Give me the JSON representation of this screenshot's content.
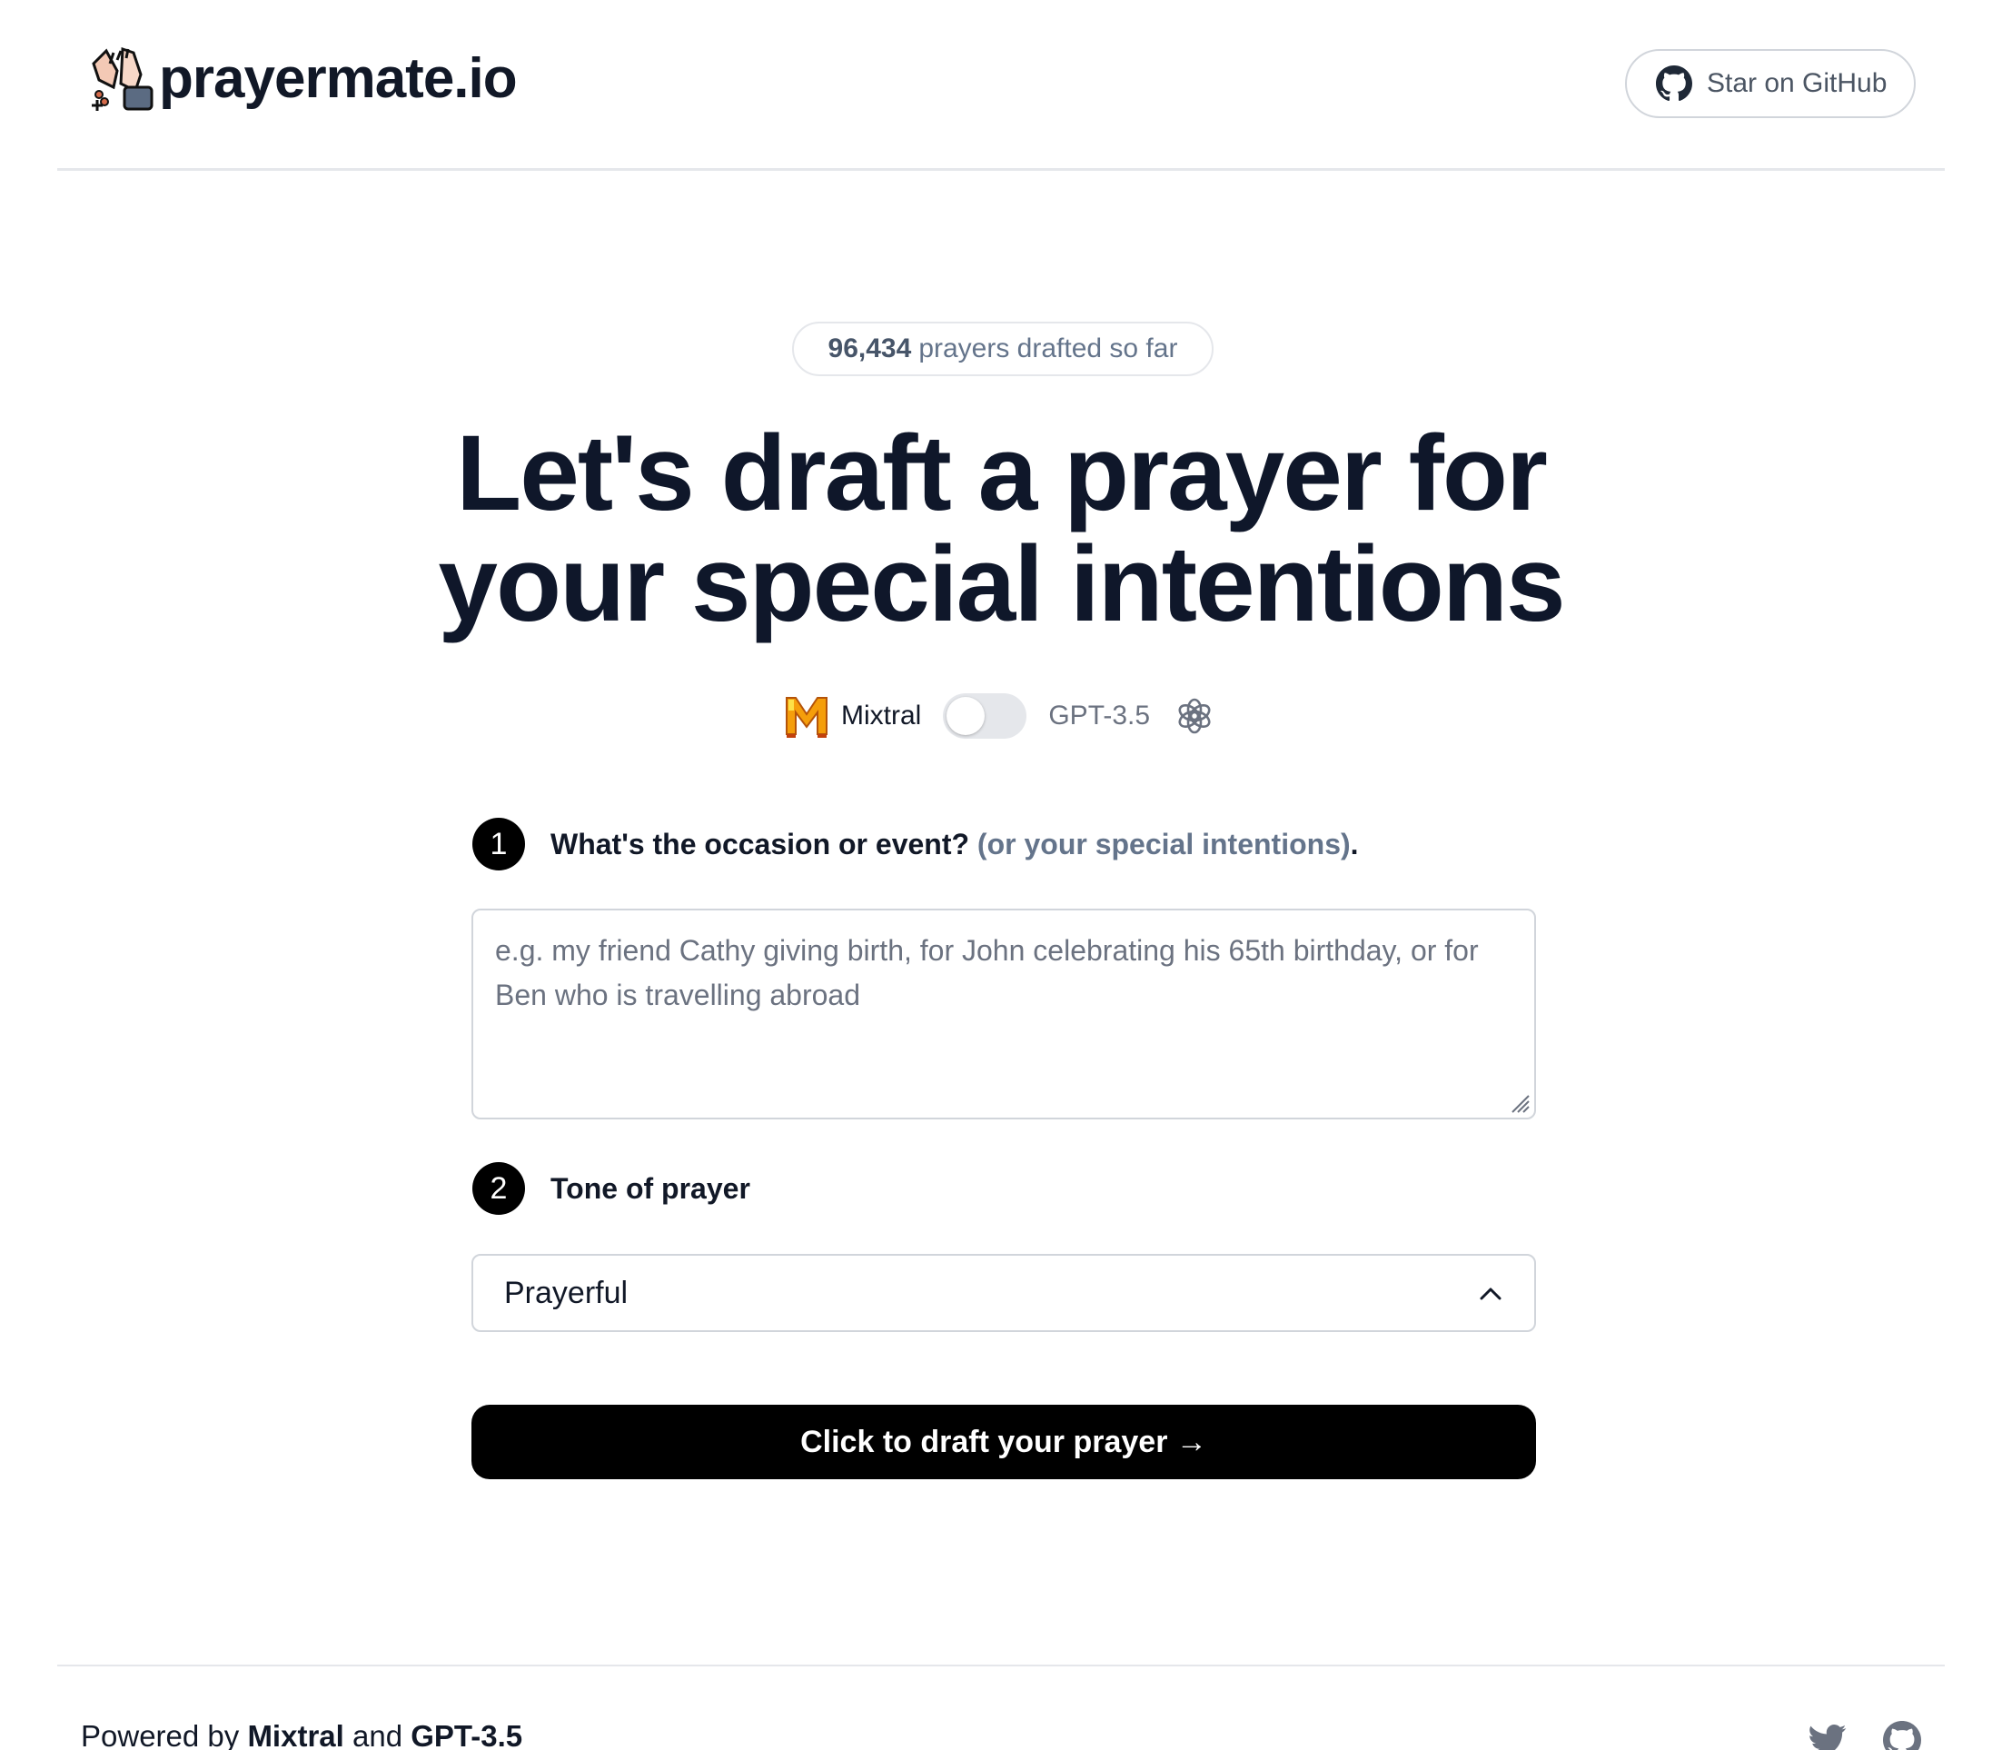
{
  "header": {
    "brand": "prayermate.io",
    "github_button": "Star on GitHub"
  },
  "counter": {
    "count": "96,434",
    "suffix": "prayers drafted so far"
  },
  "hero": {
    "line1": "Let's draft a prayer for",
    "line2": "your special intentions"
  },
  "models": {
    "left": "Mixtral",
    "right": "GPT-3.5",
    "toggle_on": false
  },
  "step1": {
    "number": "1",
    "label": "What's the occasion or event?",
    "hint": "(or your special intentions)",
    "end": ".",
    "placeholder": "e.g. my friend Cathy giving birth, for John celebrating his 65th birthday, or for Ben who is travelling abroad",
    "value": ""
  },
  "step2": {
    "number": "2",
    "label": "Tone of prayer",
    "selected": "Prayerful"
  },
  "cta": {
    "label": "Click to draft your prayer →"
  },
  "footer": {
    "powered_prefix": "Powered by",
    "model_a": "Mixtral",
    "and": "and",
    "model_b": "GPT-3.5"
  },
  "icons": {
    "logo": "praying-hands-icon",
    "github": "github-icon",
    "mixtral": "mixtral-logo-icon",
    "openai": "openai-icon",
    "select": "chevron-up-icon",
    "twitter": "twitter-icon"
  },
  "colors": {
    "primary_button": "#000000",
    "muted_text": "#64748b",
    "border": "#d1d5db"
  }
}
